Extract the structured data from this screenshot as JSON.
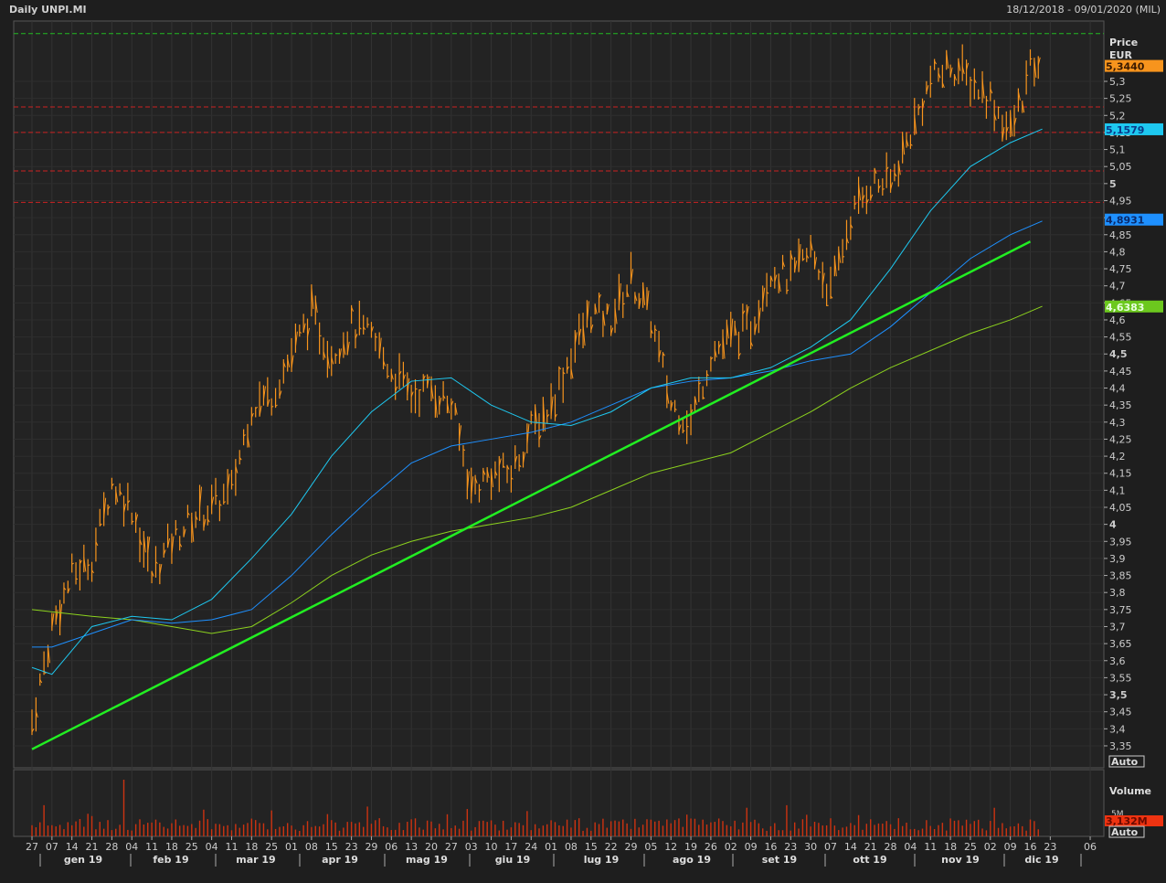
{
  "header": {
    "title": "Daily UNPI.MI",
    "range": "18/12/2018 - 09/01/2020 (MIL)"
  },
  "colors": {
    "bars": "#f7941d",
    "ma_fast": "#1ec8f0",
    "ma_mid": "#1e90ff",
    "ma_slow": "#8cd21e",
    "trend": "#22ee22",
    "res": "#cc2222",
    "top": "#22bb22",
    "volume": "#cc3311"
  },
  "chart_data": {
    "type": "bar",
    "title": "Daily UNPI.MI",
    "ylabel": "Price EUR",
    "ylim": [
      3.33,
      5.47
    ],
    "yticks": [
      "5,3",
      "5,25",
      "5,2",
      "5,15",
      "5,1",
      "5,05",
      "5",
      "4,95",
      "4,9",
      "4,85",
      "4,8",
      "4,75",
      "4,7",
      "4,65",
      "4,6",
      "4,55",
      "4,5",
      "4,45",
      "4,4",
      "4,35",
      "4,3",
      "4,25",
      "4,2",
      "4,15",
      "4,1",
      "4,05",
      "4",
      "3,95",
      "3,9",
      "3,85",
      "3,8",
      "3,75",
      "3,7",
      "3,65",
      "3,6",
      "3,55",
      "3,5",
      "3,45",
      "3,4",
      "3,35"
    ],
    "xticks": [
      "27",
      "07",
      "14",
      "21",
      "28",
      "04",
      "11",
      "18",
      "25",
      "04",
      "11",
      "18",
      "25",
      "01",
      "08",
      "15",
      "23",
      "29",
      "06",
      "13",
      "20",
      "27",
      "03",
      "10",
      "17",
      "24",
      "01",
      "08",
      "15",
      "22",
      "29",
      "05",
      "12",
      "19",
      "26",
      "02",
      "09",
      "16",
      "23",
      "30",
      "07",
      "14",
      "21",
      "28",
      "04",
      "11",
      "18",
      "25",
      "02",
      "09",
      "16",
      "23",
      "06"
    ],
    "months": [
      "gen 19",
      "feb 19",
      "mar 19",
      "apr 19",
      "mag 19",
      "giu 19",
      "lug 19",
      "ago 19",
      "set 19",
      "ott 19",
      "nov 19",
      "dic 19"
    ],
    "weekly_close": [
      3.42,
      3.7,
      3.85,
      3.9,
      4.12,
      4.05,
      3.85,
      3.95,
      4.02,
      4.05,
      4.1,
      4.35,
      4.38,
      4.5,
      4.62,
      4.5,
      4.58,
      4.55,
      4.45,
      4.38,
      4.4,
      4.35,
      4.1,
      4.15,
      4.15,
      4.28,
      4.35,
      4.5,
      4.62,
      4.6,
      4.72,
      4.6,
      4.35,
      4.3,
      4.5,
      4.55,
      4.58,
      4.75,
      4.72,
      4.8,
      4.68,
      4.9,
      5.0,
      5.0,
      5.15,
      5.3,
      5.35,
      5.3,
      5.25,
      5.15,
      5.33
    ],
    "ma_fast": [
      [
        0,
        3.58
      ],
      [
        1,
        3.56
      ],
      [
        3,
        3.7
      ],
      [
        5,
        3.73
      ],
      [
        7,
        3.72
      ],
      [
        9,
        3.78
      ],
      [
        11,
        3.9
      ],
      [
        13,
        4.03
      ],
      [
        15,
        4.2
      ],
      [
        17,
        4.33
      ],
      [
        19,
        4.42
      ],
      [
        21,
        4.43
      ],
      [
        23,
        4.35
      ],
      [
        25,
        4.3
      ],
      [
        27,
        4.29
      ],
      [
        29,
        4.33
      ],
      [
        31,
        4.4
      ],
      [
        33,
        4.43
      ],
      [
        35,
        4.43
      ],
      [
        37,
        4.46
      ],
      [
        39,
        4.52
      ],
      [
        41,
        4.6
      ],
      [
        43,
        4.75
      ],
      [
        45,
        4.92
      ],
      [
        47,
        5.05
      ],
      [
        49,
        5.12
      ],
      [
        50.6,
        5.16
      ]
    ],
    "ma_mid": [
      [
        0,
        3.64
      ],
      [
        1,
        3.64
      ],
      [
        5,
        3.72
      ],
      [
        7,
        3.71
      ],
      [
        9,
        3.72
      ],
      [
        11,
        3.75
      ],
      [
        13,
        3.85
      ],
      [
        15,
        3.97
      ],
      [
        17,
        4.08
      ],
      [
        19,
        4.18
      ],
      [
        21,
        4.23
      ],
      [
        23,
        4.25
      ],
      [
        25,
        4.27
      ],
      [
        27,
        4.3
      ],
      [
        29,
        4.35
      ],
      [
        31,
        4.4
      ],
      [
        33,
        4.42
      ],
      [
        35,
        4.43
      ],
      [
        37,
        4.45
      ],
      [
        39,
        4.48
      ],
      [
        41,
        4.5
      ],
      [
        43,
        4.58
      ],
      [
        45,
        4.68
      ],
      [
        47,
        4.78
      ],
      [
        49,
        4.85
      ],
      [
        50.6,
        4.89
      ]
    ],
    "ma_slow": [
      [
        0,
        3.75
      ],
      [
        3,
        3.73
      ],
      [
        5,
        3.72
      ],
      [
        7,
        3.7
      ],
      [
        9,
        3.68
      ],
      [
        11,
        3.7
      ],
      [
        13,
        3.77
      ],
      [
        15,
        3.85
      ],
      [
        17,
        3.91
      ],
      [
        19,
        3.95
      ],
      [
        21,
        3.98
      ],
      [
        23,
        4.0
      ],
      [
        25,
        4.02
      ],
      [
        27,
        4.05
      ],
      [
        29,
        4.1
      ],
      [
        31,
        4.15
      ],
      [
        33,
        4.18
      ],
      [
        35,
        4.21
      ],
      [
        37,
        4.27
      ],
      [
        39,
        4.33
      ],
      [
        41,
        4.4
      ],
      [
        43,
        4.46
      ],
      [
        45,
        4.51
      ],
      [
        47,
        4.56
      ],
      [
        49,
        4.6
      ],
      [
        50.6,
        4.64
      ]
    ],
    "trendline": [
      [
        0,
        3.34
      ],
      [
        50,
        4.83
      ]
    ],
    "hlines": {
      "top": 5.44,
      "resistance": [
        5.225,
        5.15,
        5.037,
        4.945
      ]
    },
    "last_labels": [
      {
        "text": "5,3440",
        "value": 5.344,
        "bg": "#f7941d",
        "fg": "#3a1a00"
      },
      {
        "text": "5,1579",
        "value": 5.158,
        "bg": "#1ec8f0",
        "fg": "#0a3a8a"
      },
      {
        "text": "4,8931",
        "value": 4.893,
        "bg": "#1e90ff",
        "fg": "#0a2a6a"
      },
      {
        "text": "4,6383",
        "value": 4.638,
        "bg": "#6cc81e",
        "fg": "#e8ffe0"
      }
    ],
    "volume": {
      "label": "Volume",
      "tick": "5M",
      "last": "3,132M",
      "scale_btn": "Auto"
    },
    "price_scale_btn": "Auto",
    "price_label": "Price",
    "currency": "EUR"
  }
}
